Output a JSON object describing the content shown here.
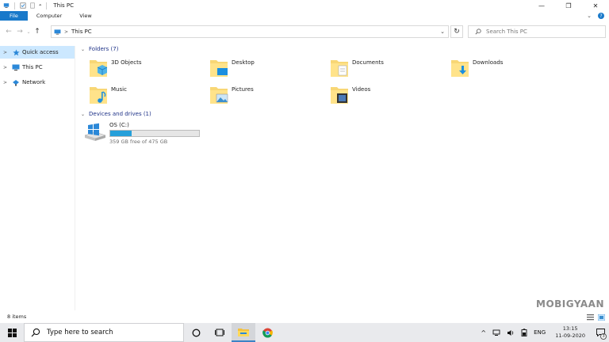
{
  "window": {
    "title": "This PC",
    "controls": {
      "minimize": "—",
      "maximize": "❐",
      "close": "✕"
    }
  },
  "ribbon": {
    "tabs": [
      {
        "label": "File"
      },
      {
        "label": "Computer"
      },
      {
        "label": "View"
      }
    ],
    "expand": "⌄",
    "help": "?"
  },
  "address": {
    "back": "←",
    "forward": "→",
    "recent": "⌄",
    "up": "↑",
    "path": "This PC",
    "dropdown": "⌄",
    "refresh": "↻"
  },
  "search": {
    "placeholder": "Search This PC"
  },
  "nav": {
    "items": [
      {
        "label": "Quick access",
        "icon": "star-icon",
        "selected": true
      },
      {
        "label": "This PC",
        "icon": "computer-icon"
      },
      {
        "label": "Network",
        "icon": "network-icon"
      }
    ]
  },
  "folders_group": {
    "header": "Folders (7)",
    "items": [
      {
        "label": "3D Objects",
        "icon": "3d-objects-folder-icon"
      },
      {
        "label": "Desktop",
        "icon": "desktop-folder-icon"
      },
      {
        "label": "Documents",
        "icon": "documents-folder-icon"
      },
      {
        "label": "Downloads",
        "icon": "downloads-folder-icon"
      },
      {
        "label": "Music",
        "icon": "music-folder-icon"
      },
      {
        "label": "Pictures",
        "icon": "pictures-folder-icon"
      },
      {
        "label": "Videos",
        "icon": "videos-folder-icon"
      }
    ]
  },
  "drives_group": {
    "header": "Devices and drives (1)",
    "drives": [
      {
        "name": "OS (C:)",
        "free_text": "359 GB free of 475 GB",
        "used_fraction": 0.244,
        "icon": "windows-drive-icon"
      }
    ]
  },
  "status": {
    "item_count": "8 items"
  },
  "watermark": "MOBIGYAAN",
  "taskbar": {
    "search_placeholder": "Type here to search",
    "language": "ENG",
    "time": "13:15",
    "date": "11-09-2020",
    "notification_count": "3",
    "tray_chevron": "^"
  },
  "colors": {
    "accent": "#1979ca",
    "selection": "#cce8ff",
    "folder": "#f8d775",
    "drive_fill": "#26a0da",
    "group_header": "#1e3287",
    "taskbar": "#e9eaed"
  }
}
